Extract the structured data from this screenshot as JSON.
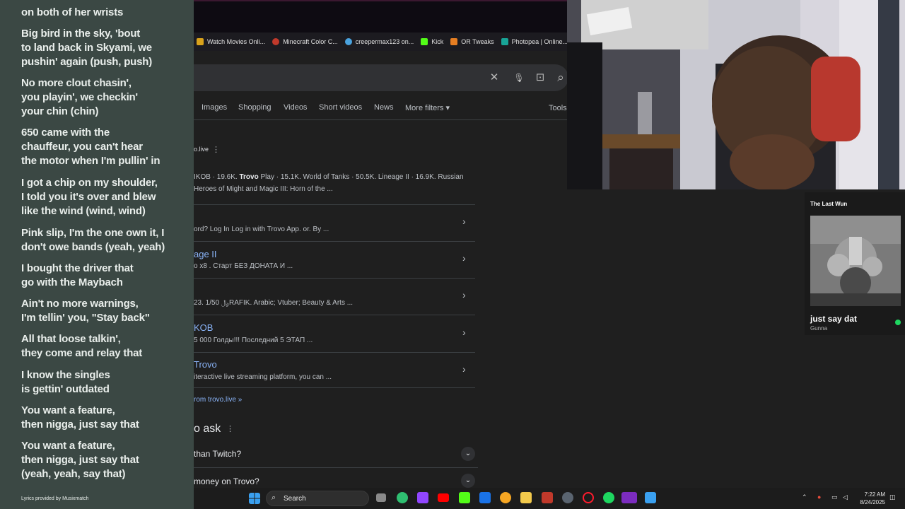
{
  "bookmarks": [
    {
      "label": "Watch Movies Onli...",
      "color": "#d9a21b"
    },
    {
      "label": "Minecraft Color C...",
      "color": "#c0392b"
    },
    {
      "label": "creepermax123 on...",
      "color": "#4aa3df"
    },
    {
      "label": "Kick",
      "color": "#53fc18"
    },
    {
      "label": "OR Tweaks",
      "color": "#e67e22"
    },
    {
      "label": "Photopea | Online...",
      "color": "#18a497"
    }
  ],
  "search": {
    "clear_icon": "✕",
    "mic_icon": "🎙",
    "lens_icon": "⊡",
    "search_icon": "⌕"
  },
  "filters": [
    "Images",
    "Shopping",
    "Videos",
    "Short videos",
    "News",
    "More filters ▾"
  ],
  "tools_label": "Tools",
  "result": {
    "site": "o.live",
    "snippet_line1_a": "IKOB · 19.6K. ",
    "snippet_line1_bold": "Trovo",
    "snippet_line1_b": " Play · 15.1K. World of Tanks · 50.5K. Lineage II · 16.9K. Russian",
    "snippet_line2": "Heroes of Might and Magic III: Horn of the ...",
    "sitelinks": [
      {
        "title": "",
        "snippet": "ord? Log In Log in with Trovo App. or. By ..."
      },
      {
        "title": "age II",
        "snippet": "o x8 . Старт БЕЗ ДОНАТА И ..."
      },
      {
        "title": "",
        "snippet": "23. 1/50 ﷼RAFIK. Arabic; Vtuber; Beauty & Arts ..."
      },
      {
        "title": "KOB",
        "snippet": "5 000 Голды!!! Последний 5 ЭТАП ..."
      },
      {
        "title": "Trovo",
        "snippet": "iteractive live streaming platform, you can ..."
      }
    ],
    "more_results": "rom trovo.live »"
  },
  "paa": {
    "title": "o ask",
    "questions": [
      " than Twitch?",
      " money on Trovo?"
    ]
  },
  "now_playing": {
    "header": "The Last Wun",
    "title": "just say dat",
    "artist": "Gunna"
  },
  "lyrics": [
    {
      "text": "on both of her wrists"
    },
    {
      "text": "Big bird in the sky, 'bout\nto land back in Skyami, we\npushin' again (push, push)"
    },
    {
      "text": "No more clout chasin',\nyou playin', we checkin'\nyour chin (chin)"
    },
    {
      "text": "650 came with the\nchauffeur, you can't hear\nthe motor when I'm pullin' in"
    },
    {
      "text": "I got a chip on my shoulder,\nI told you it's over and blew\nlike the wind (wind, wind)"
    },
    {
      "text": "Pink slip, I'm the one own it, I\ndon't owe bands (yeah, yeah)"
    },
    {
      "text": "I bought the driver that\ngo with the Maybach"
    },
    {
      "text": "Ain't no more warnings,\nI'm tellin' you, \"Stay back\""
    },
    {
      "text": "All that loose talkin',\nthey come and relay that"
    },
    {
      "text": "I know the singles\nis gettin' outdated"
    },
    {
      "text": "You want a feature,\nthen nigga, just say that"
    },
    {
      "text": "You want a feature,\nthen nigga, just say that\n(yeah, yeah, say that)"
    }
  ],
  "lyrics_credit": "Lyrics provided by Musixmatch",
  "taskbar": {
    "search_label": "Search",
    "time": "7:22 AM",
    "date": "8/24/2025"
  }
}
